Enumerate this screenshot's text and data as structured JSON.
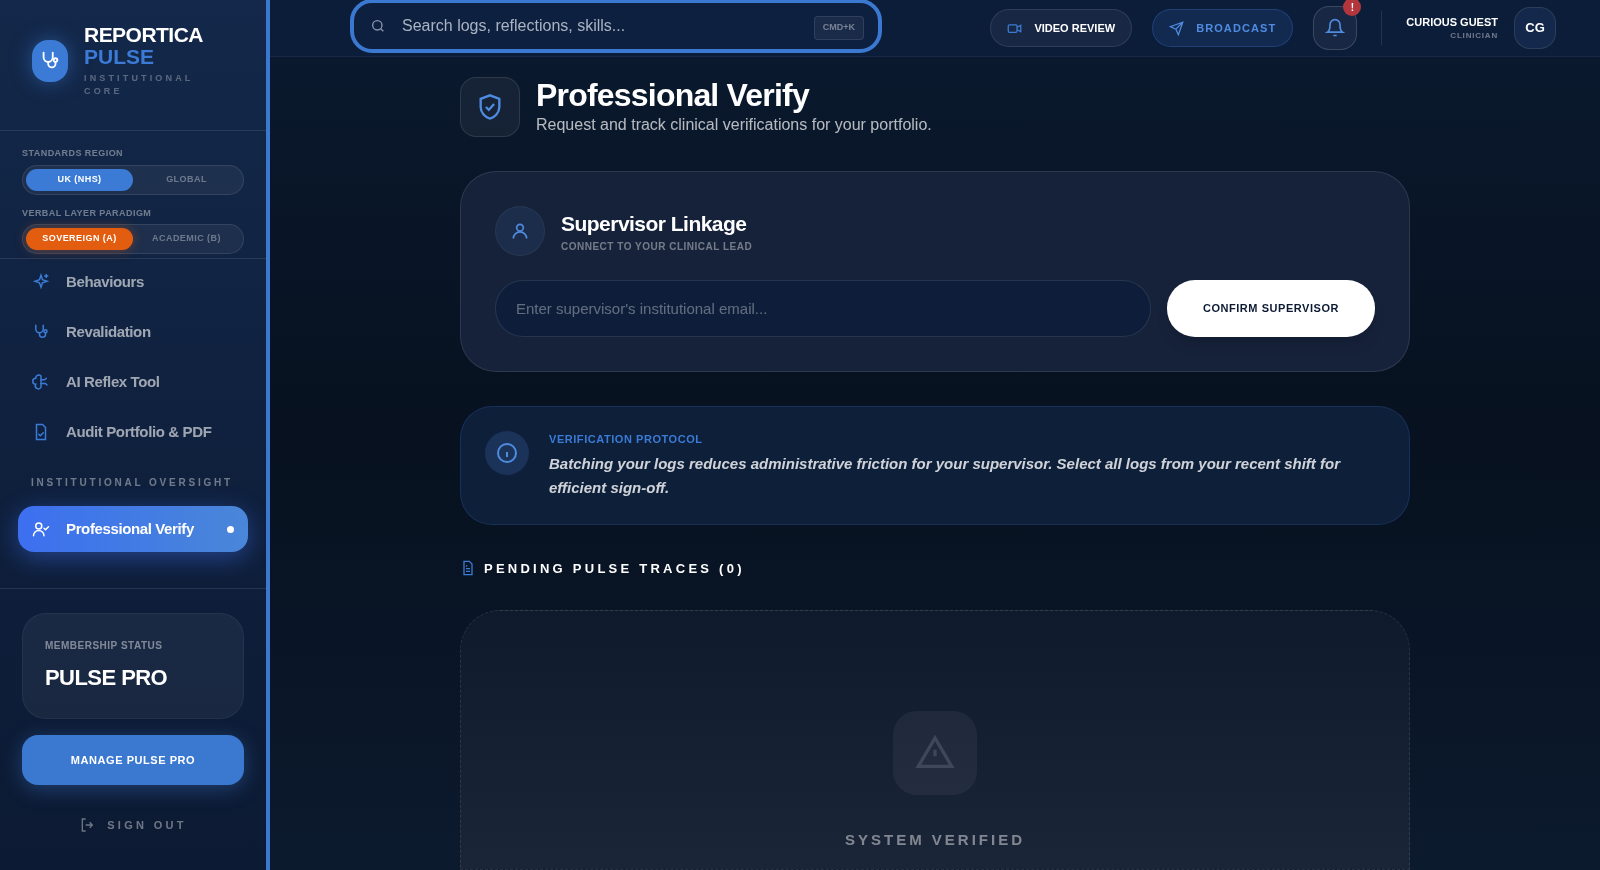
{
  "sidebar": {
    "brand": {
      "name": "REPORTICA",
      "accent": "PULSE",
      "tagline": "INSTITUTIONAL CORE"
    },
    "toggles": [
      {
        "label": "STANDARDS REGION",
        "kind": "blue",
        "options": [
          {
            "label": "UK (NHS)",
            "selected": true
          },
          {
            "label": "GLOBAL",
            "selected": false
          }
        ]
      },
      {
        "label": "VERBAL LAYER PARADIGM",
        "kind": "orange",
        "options": [
          {
            "label": "SOVEREIGN (A)",
            "selected": true
          },
          {
            "label": "ACADEMIC (B)",
            "selected": false
          }
        ]
      }
    ],
    "nav_items": [
      {
        "label": "Behaviours",
        "kind": "sparkle",
        "selected": false
      },
      {
        "label": "Revalidation",
        "kind": "stethoscope",
        "selected": false
      },
      {
        "label": "AI Reflex Tool",
        "kind": "brain",
        "selected": false
      },
      {
        "label": "Audit Portfolio & PDF",
        "kind": "file",
        "selected": false
      }
    ],
    "section_heading": "INSTITUTIONAL OVERSIGHT",
    "oversight_items": [
      {
        "label": "Professional Verify",
        "kind": "user-check",
        "selected": true
      }
    ],
    "membership": {
      "label": "MEMBERSHIP STATUS",
      "plan": "PULSE PRO"
    },
    "manage_button": "MANAGE PULSE PRO",
    "sign_out": "SIGN OUT"
  },
  "topbar": {
    "search": {
      "placeholder": "Search logs, reflections, skills...",
      "shortcut": "CMD+K"
    },
    "video_review": "VIDEO REVIEW",
    "broadcast": "BROADCAST",
    "notification_badge": "!",
    "user": {
      "name": "CURIOUS GUEST",
      "role": "CLINICIAN",
      "initials": "CG"
    }
  },
  "page": {
    "title": "Professional Verify",
    "subtitle": "Request and track clinical verifications for your portfolio.",
    "supervisor": {
      "title": "Supervisor Linkage",
      "subtitle": "CONNECT TO YOUR CLINICAL LEAD",
      "placeholder": "Enter supervisor's institutional email...",
      "button": "CONFIRM SUPERVISOR"
    },
    "protocol": {
      "title": "VERIFICATION PROTOCOL",
      "text": "Batching your logs reduces administrative friction for your supervisor. Select all logs from your recent shift for efficient sign-off."
    },
    "pending_heading": "PENDING PULSE TRACES (0)",
    "empty_label": "SYSTEM VERIFIED"
  }
}
